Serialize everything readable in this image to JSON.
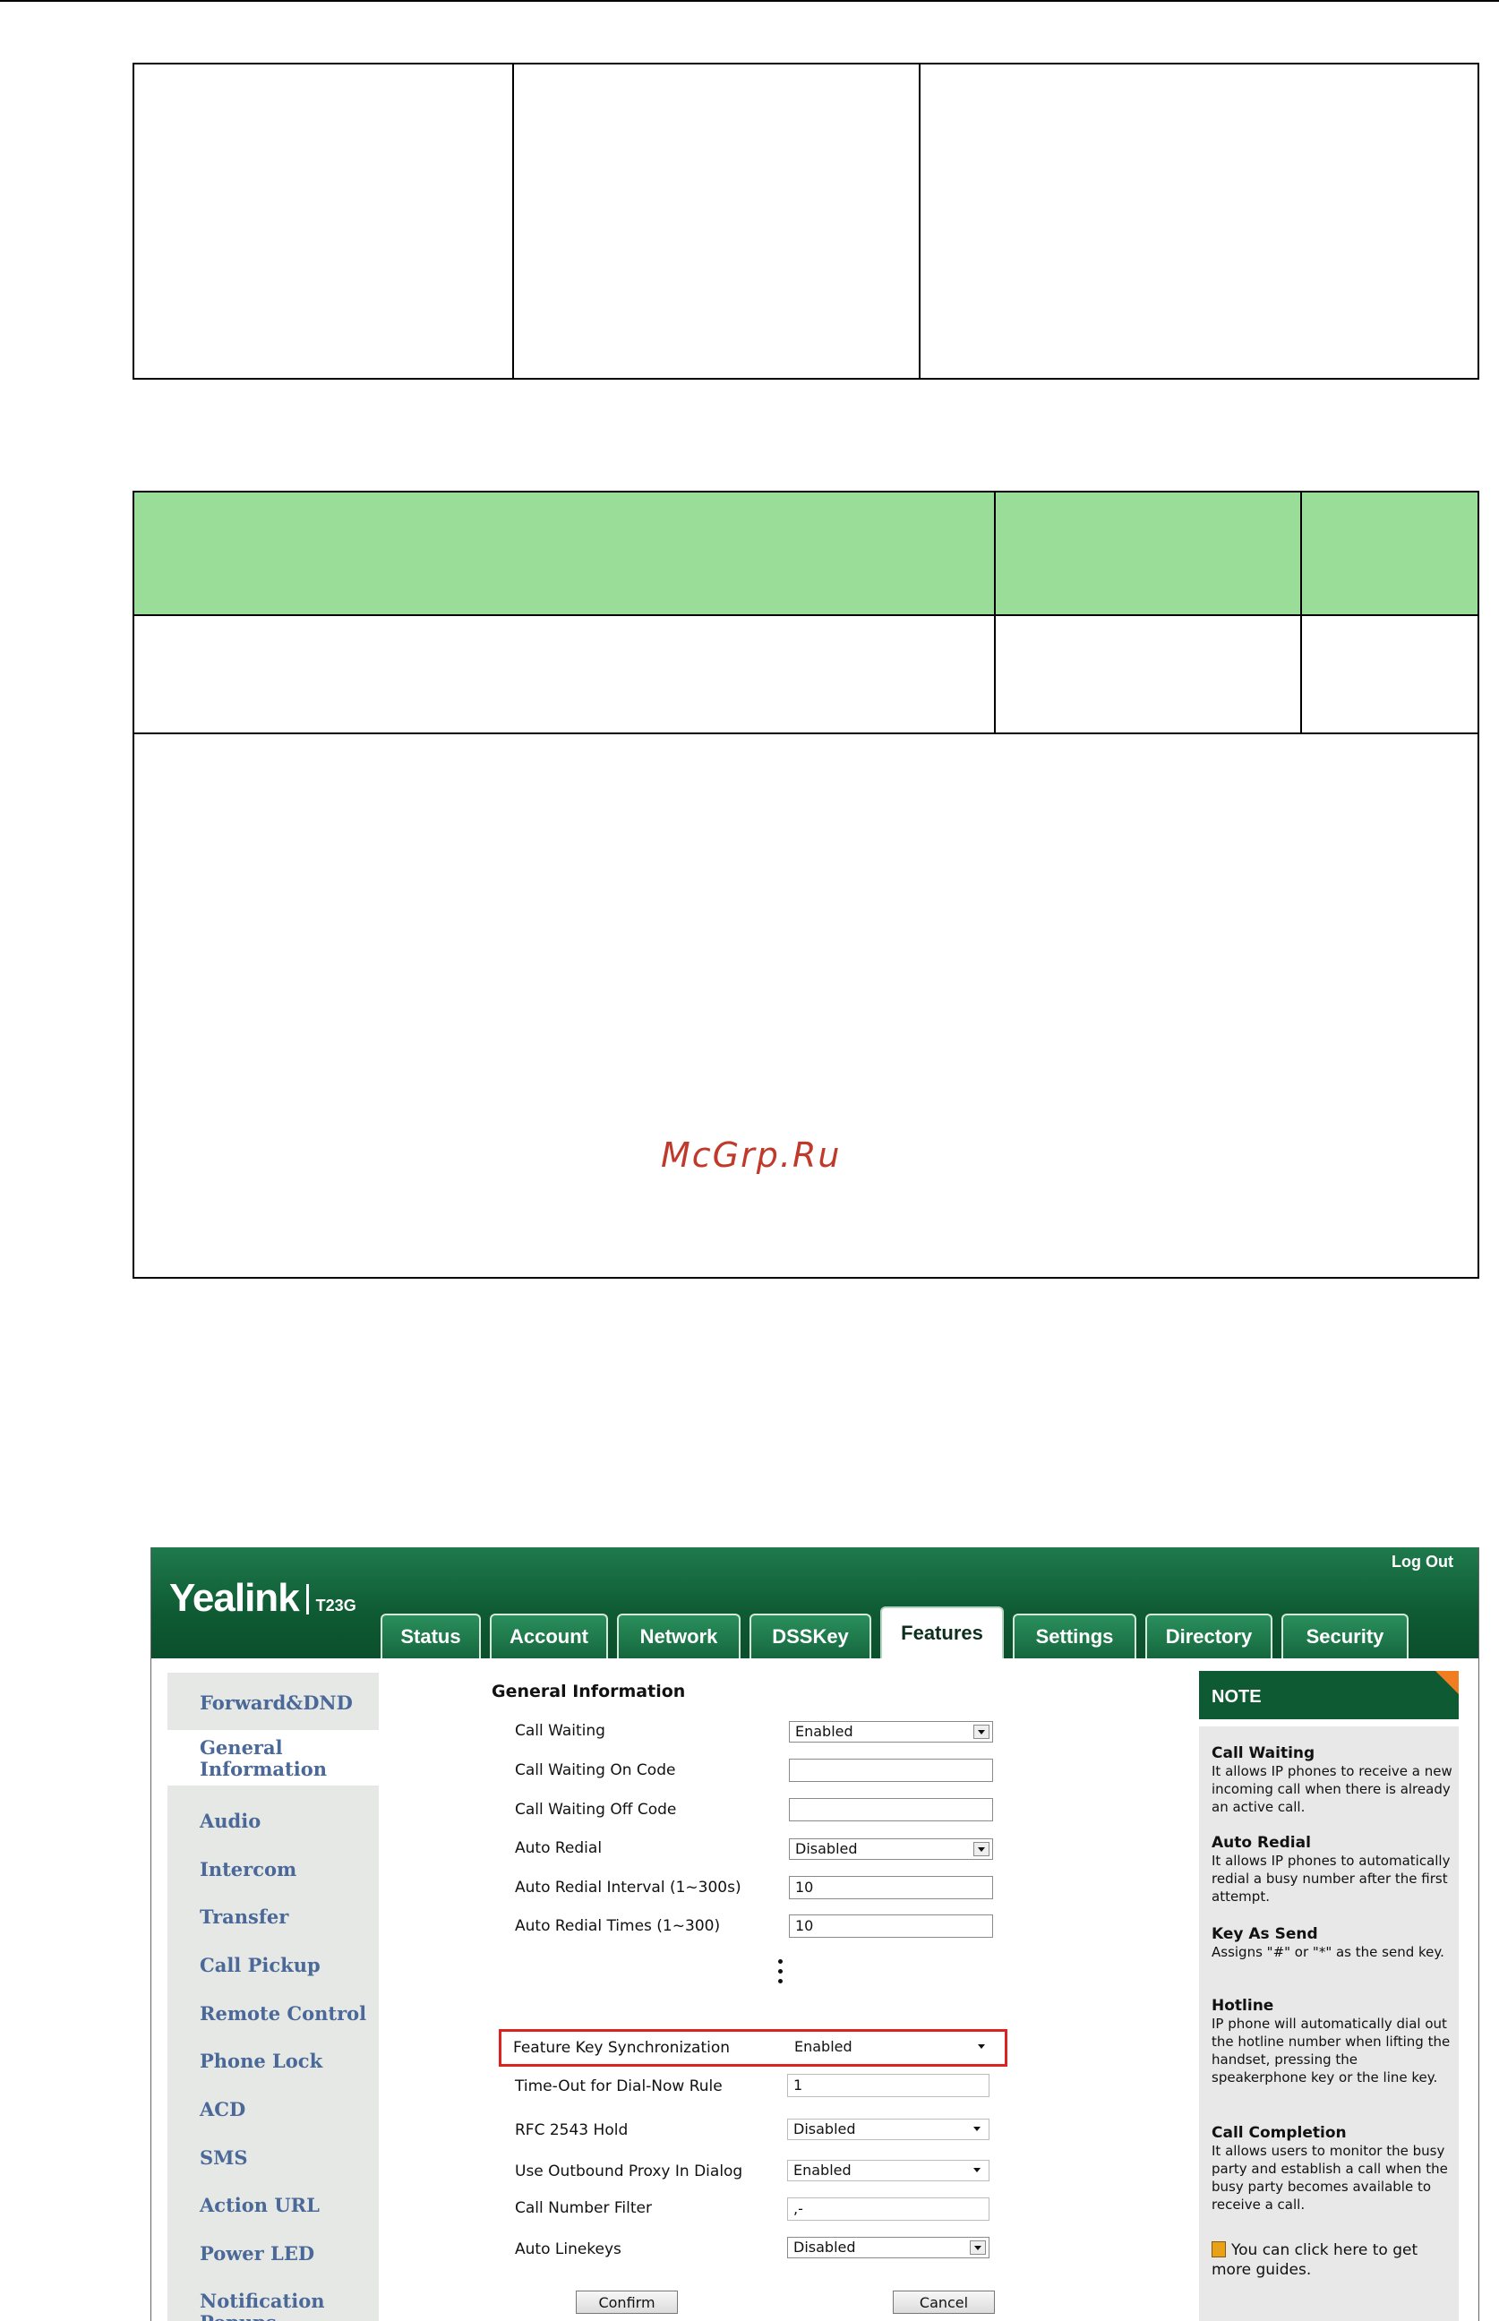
{
  "watermark": "McGrp.Ru",
  "screenshot": {
    "brand": "Yealink",
    "model": "T23G",
    "logout": "Log Out",
    "tabs": [
      "Status",
      "Account",
      "Network",
      "DSSKey",
      "Features",
      "Settings",
      "Directory",
      "Security"
    ],
    "active_tab": "Features",
    "sidebar": [
      "Forward&DND",
      "General Information",
      "Audio",
      "Intercom",
      "Transfer",
      "Call Pickup",
      "Remote Control",
      "Phone Lock",
      "ACD",
      "SMS",
      "Action URL",
      "Power LED",
      "Notification Popups"
    ],
    "active_sidebar": "General Information",
    "section_title": "General Information",
    "rows": [
      {
        "label": "Call Waiting",
        "value": "Enabled",
        "type": "select"
      },
      {
        "label": "Call Waiting On Code",
        "value": "",
        "type": "input"
      },
      {
        "label": "Call Waiting Off Code",
        "value": "",
        "type": "input"
      },
      {
        "label": "Auto Redial",
        "value": "Disabled",
        "type": "select"
      },
      {
        "label": "Auto Redial Interval (1~300s)",
        "value": "10",
        "type": "input"
      },
      {
        "label": "Auto Redial Times (1~300)",
        "value": "10",
        "type": "input"
      },
      {
        "label": "Feature Key Synchronization",
        "value": "Enabled",
        "type": "select"
      },
      {
        "label": "Time-Out for Dial-Now Rule",
        "value": "1",
        "type": "input"
      },
      {
        "label": "RFC 2543 Hold",
        "value": "Disabled",
        "type": "select"
      },
      {
        "label": "Use Outbound Proxy In Dialog",
        "value": "Enabled",
        "type": "select"
      },
      {
        "label": "Call Number Filter",
        "value": ",-",
        "type": "input"
      },
      {
        "label": "Auto Linekeys",
        "value": "Disabled",
        "type": "select"
      }
    ],
    "buttons": {
      "confirm": "Confirm",
      "cancel": "Cancel"
    },
    "note": {
      "title": "NOTE",
      "entries": [
        {
          "title": "Call Waiting",
          "text": "It allows IP phones to receive a new incoming call when there is already an active call."
        },
        {
          "title": "Auto Redial",
          "text": "It allows IP phones to automatically redial a busy number after the first attempt."
        },
        {
          "title": "Key As Send",
          "text": "Assigns \"#\" or \"*\" as the send key."
        },
        {
          "title": "Hotline",
          "text": "IP phone will automatically dial out the hotline number when lifting the handset, pressing the speakerphone key or the line key."
        },
        {
          "title": "Call Completion",
          "text": "It allows users to monitor the busy party and establish a call when the busy party becomes available to receive a call."
        }
      ],
      "guide": "You can click here to get more guides."
    }
  }
}
